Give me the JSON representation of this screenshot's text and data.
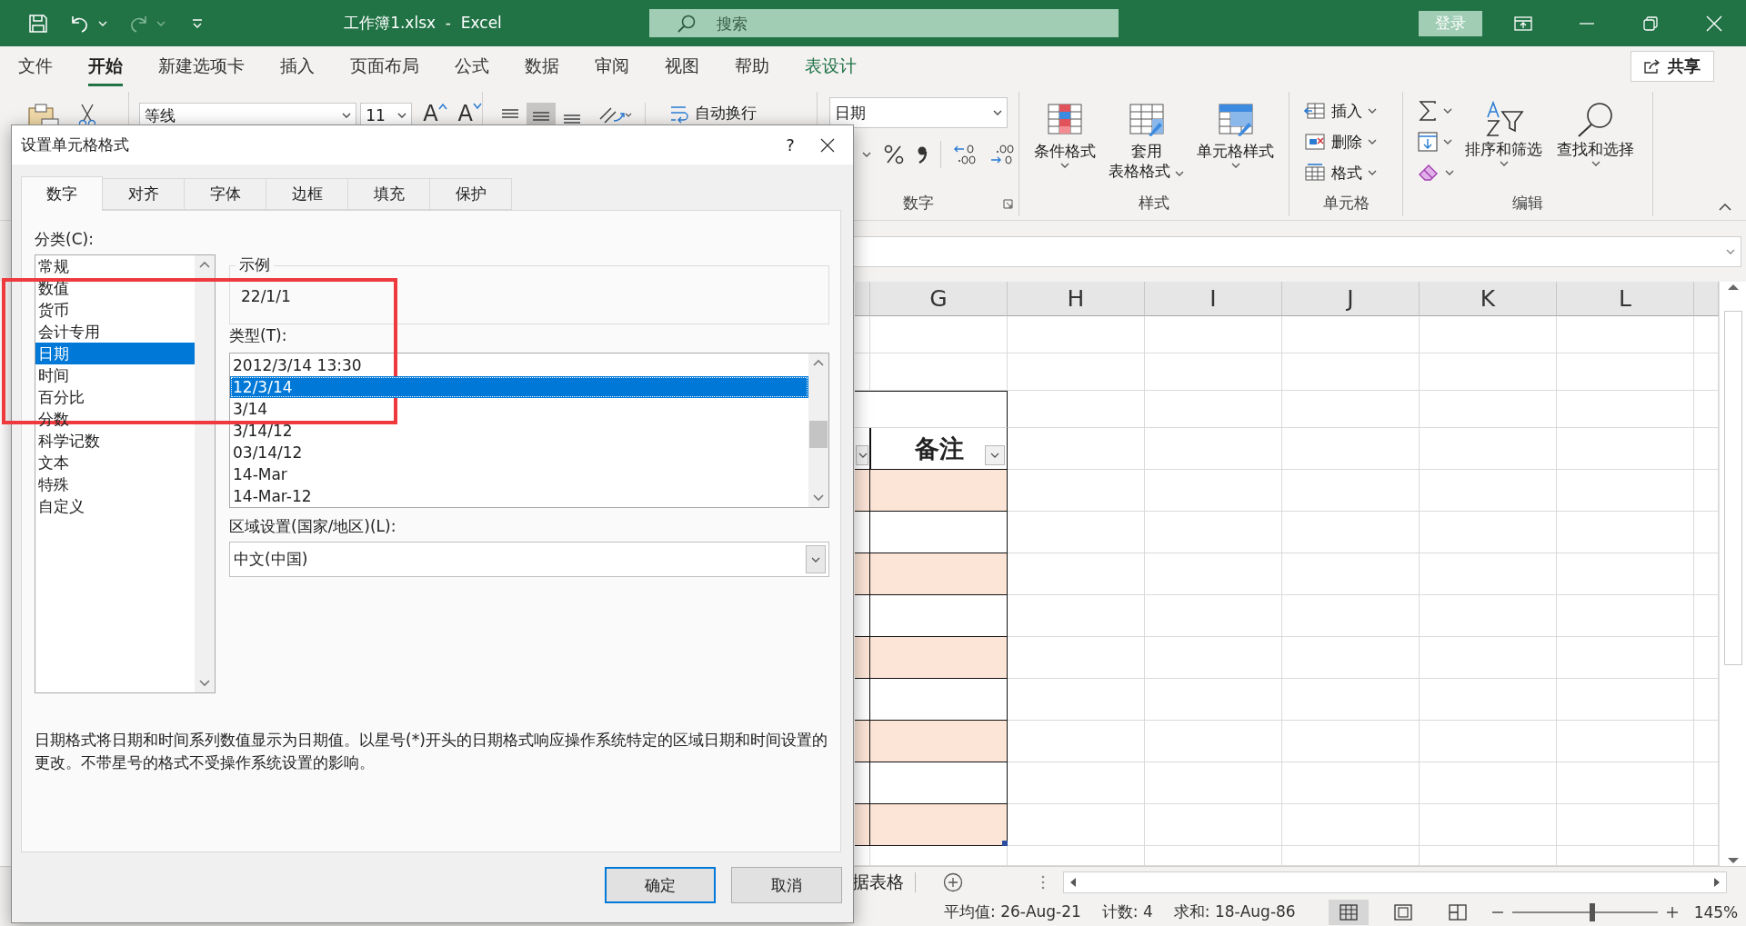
{
  "title_bar": {
    "document_title": "工作簿1.xlsx  -  Excel",
    "search_placeholder": "搜索",
    "sign_in": "登录"
  },
  "menu_tabs": [
    {
      "label": "文件",
      "selected": false,
      "contextual": false
    },
    {
      "label": "开始",
      "selected": true,
      "contextual": false
    },
    {
      "label": "新建选项卡",
      "selected": false,
      "contextual": false
    },
    {
      "label": "插入",
      "selected": false,
      "contextual": false
    },
    {
      "label": "页面布局",
      "selected": false,
      "contextual": false
    },
    {
      "label": "公式",
      "selected": false,
      "contextual": false
    },
    {
      "label": "数据",
      "selected": false,
      "contextual": false
    },
    {
      "label": "审阅",
      "selected": false,
      "contextual": false
    },
    {
      "label": "视图",
      "selected": false,
      "contextual": false
    },
    {
      "label": "帮助",
      "selected": false,
      "contextual": false
    },
    {
      "label": "表设计",
      "selected": false,
      "contextual": true
    }
  ],
  "share": "共享",
  "ribbon": {
    "font": {
      "name": "等线",
      "size": "11",
      "buttons": [
        {
          "glyph": "A",
          "kind": "grow"
        },
        {
          "glyph": "A",
          "kind": "shrink"
        }
      ]
    },
    "alignment": {
      "buttons": [
        {
          "kind": "top",
          "selected": false
        },
        {
          "kind": "middle",
          "selected": true
        },
        {
          "kind": "bottom",
          "selected": false
        }
      ],
      "wrap_text": "自动换行"
    },
    "number": {
      "format": "日期",
      "label": "数字"
    },
    "styles": {
      "buttons": [
        {
          "lines": [
            "条件格式"
          ],
          "kind": "conditional"
        },
        {
          "lines": [
            "套用",
            "表格格式"
          ],
          "kind": "table"
        },
        {
          "lines": [
            "单元格样式"
          ],
          "kind": "cell"
        }
      ],
      "label": "样式"
    },
    "cells": {
      "buttons": [
        {
          "label": "插入",
          "kind": "insert"
        },
        {
          "label": "删除",
          "kind": "delete"
        },
        {
          "label": "格式",
          "kind": "format"
        }
      ],
      "label": "单元格"
    },
    "editing": {
      "buttons": [
        {
          "label": "排序和筛选",
          "kind": "sort"
        },
        {
          "label": "查找和选择",
          "kind": "find"
        }
      ],
      "label": "编辑"
    }
  },
  "sheet": {
    "columns": [
      "G",
      "H",
      "I",
      "J",
      "K",
      "L"
    ],
    "table_header": "备注"
  },
  "sheet_tabs": [
    {
      "label": "据表格"
    }
  ],
  "status_bar": {
    "average": "平均值: 26-Aug-21",
    "count": "计数: 4",
    "sum": "求和: 18-Aug-86",
    "views": [
      {
        "kind": "normal",
        "selected": true
      },
      {
        "kind": "page_layout",
        "selected": false
      },
      {
        "kind": "page_break",
        "selected": false
      }
    ],
    "zoom_slider": {
      "level": 0.55
    },
    "zoom": "145%"
  },
  "dialog": {
    "title": "设置单元格格式",
    "help": "?",
    "tabs": [
      {
        "label": "数字",
        "selected": true
      },
      {
        "label": "对齐",
        "selected": false
      },
      {
        "label": "字体",
        "selected": false
      },
      {
        "label": "边框",
        "selected": false
      },
      {
        "label": "填充",
        "selected": false
      },
      {
        "label": "保护",
        "selected": false
      }
    ],
    "category_label": "分类(C):",
    "categories": [
      {
        "label": "常规",
        "selected": false
      },
      {
        "label": "数值",
        "selected": false
      },
      {
        "label": "货币",
        "selected": false
      },
      {
        "label": "会计专用",
        "selected": false
      },
      {
        "label": "日期",
        "selected": true
      },
      {
        "label": "时间",
        "selected": false
      },
      {
        "label": "百分比",
        "selected": false
      },
      {
        "label": "分数",
        "selected": false
      },
      {
        "label": "科学记数",
        "selected": false
      },
      {
        "label": "文本",
        "selected": false
      },
      {
        "label": "特殊",
        "selected": false
      },
      {
        "label": "自定义",
        "selected": false
      }
    ],
    "sample_label": "示例",
    "sample_value": "22/1/1",
    "type_label": "类型(T):",
    "types": [
      {
        "label": "2012/3/14 13:30",
        "selected": false
      },
      {
        "label": "12/3/14",
        "selected": true
      },
      {
        "label": "3/14",
        "selected": false
      },
      {
        "label": "3/14/12",
        "selected": false
      },
      {
        "label": "03/14/12",
        "selected": false
      },
      {
        "label": "14-Mar",
        "selected": false
      },
      {
        "label": "14-Mar-12",
        "selected": false
      }
    ],
    "locale_label": "区域设置(国家/地区)(L):",
    "locale_value": "中文(中国)",
    "description": "日期格式将日期和时间系列数值显示为日期值。以星号(*)开头的日期格式响应操作系统特定的区域日期和时间设置的更改。不带星号的格式不受操作系统设置的影响。",
    "buttons": [
      {
        "label": "确定",
        "default": true
      },
      {
        "label": "取消",
        "default": false
      }
    ]
  }
}
